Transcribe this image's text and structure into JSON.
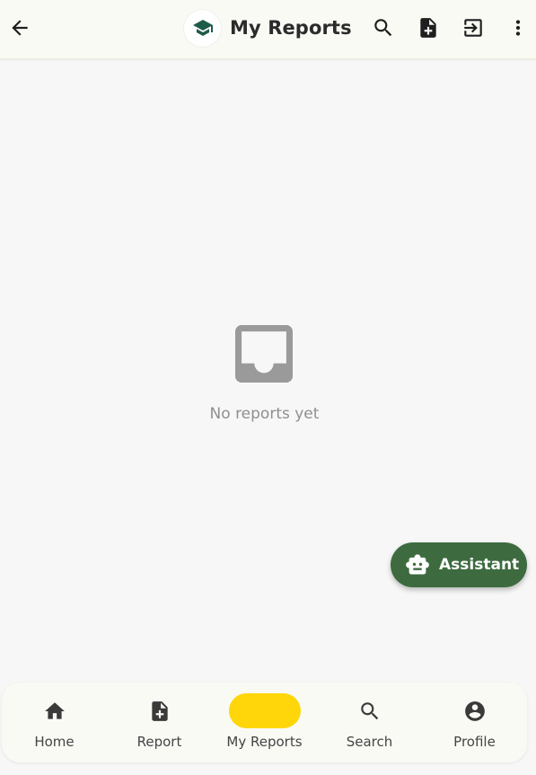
{
  "header": {
    "title": "My Reports",
    "back_icon": "arrow-back-icon",
    "logo_icon": "graduation-cap-icon",
    "actions": [
      "search-icon",
      "note-add-icon",
      "logout-icon",
      "more-vert-icon"
    ]
  },
  "empty_state": {
    "icon": "inbox-icon",
    "message": "No reports yet"
  },
  "fab": {
    "label": "Assistant",
    "icon": "robot-icon"
  },
  "bottom_nav": {
    "items": [
      {
        "label": "Home",
        "icon": "home-icon"
      },
      {
        "label": "Report",
        "icon": "note-add-icon"
      },
      {
        "label": "My Reports",
        "icon": "",
        "active": true
      },
      {
        "label": "Search",
        "icon": "search-icon"
      },
      {
        "label": "Profile",
        "icon": "account-circle-icon"
      }
    ]
  },
  "colors": {
    "appbar_bg": "#f9faf4",
    "accent_green": "#3d6b3f",
    "logo_green": "#1f5b4a",
    "active_pill": "#ffd60a",
    "empty_gray": "#8f8f8f"
  }
}
